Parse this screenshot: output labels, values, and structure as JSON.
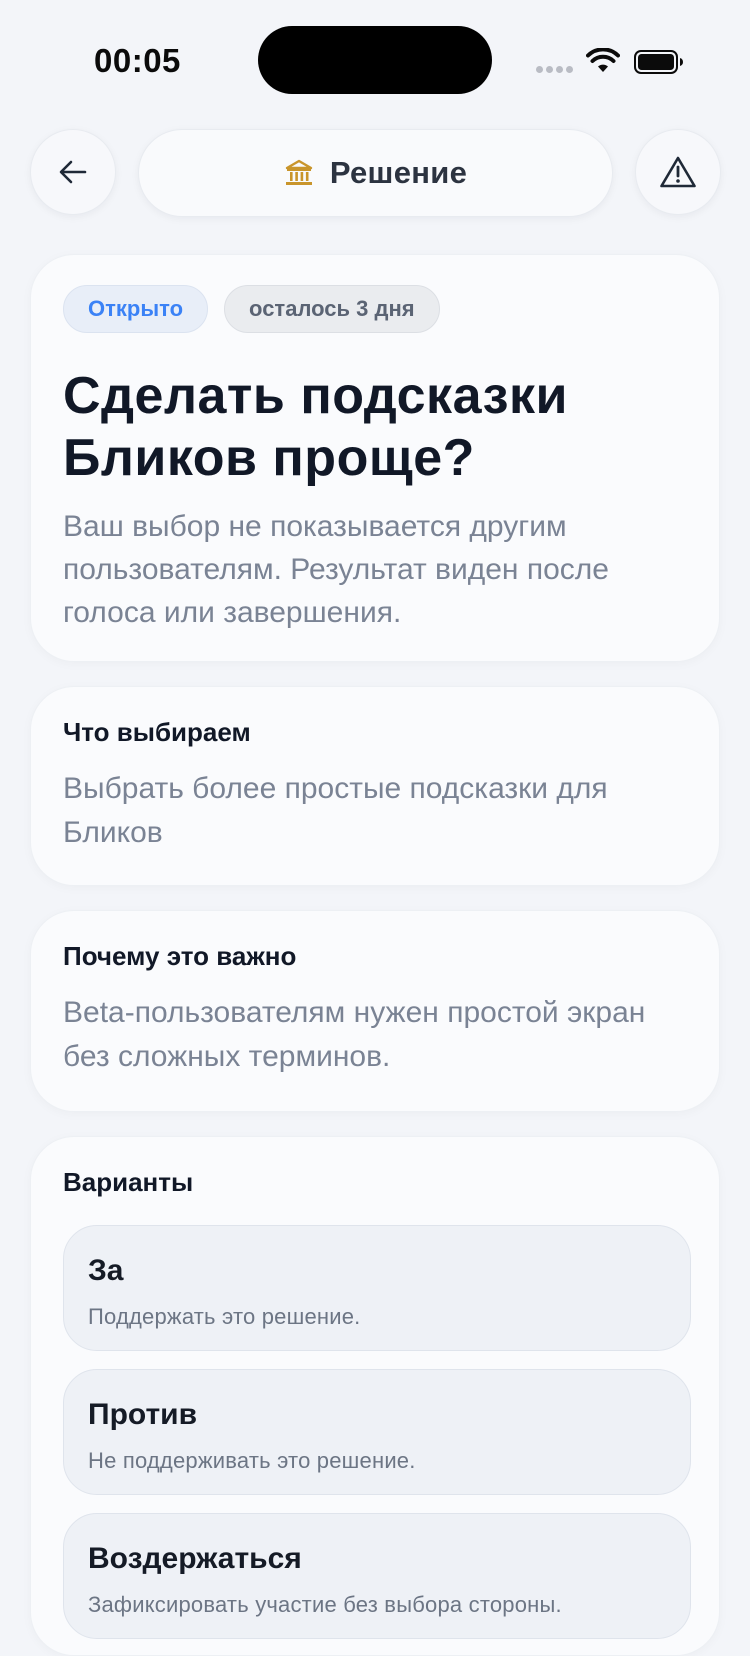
{
  "status_bar": {
    "time": "00:05",
    "icons": [
      "signal-dots-icon",
      "wifi-icon",
      "battery-icon"
    ]
  },
  "nav": {
    "back_icon": "arrow-left-icon",
    "title_icon": "bank-icon",
    "title": "Решение",
    "report_icon": "warning-triangle-icon"
  },
  "hero": {
    "status_badge": "Открыто",
    "time_badge": "осталось 3 дня",
    "title": "Сделать подсказки Бликов проще?",
    "subtitle": "Ваш выбор не показывается другим пользователям. Результат виден после голоса или завершения."
  },
  "what": {
    "heading": "Что выбираем",
    "body": "Выбрать более простые подсказки для Бликов"
  },
  "why": {
    "heading": "Почему это важно",
    "body": "Beta-пользователям нужен простой экран без сложных терминов."
  },
  "options": {
    "heading": "Варианты",
    "items": [
      {
        "label": "За",
        "description": "Поддержать это решение."
      },
      {
        "label": "Против",
        "description": "Не поддерживать это решение."
      },
      {
        "label": "Воздержаться",
        "description": "Зафиксировать участие без выбора стороны."
      }
    ]
  },
  "colors": {
    "background": "#f3f5f9",
    "accent_blue": "#3b82f6",
    "title_icon_gold": "#c9952b",
    "muted_text": "#7a8394"
  }
}
